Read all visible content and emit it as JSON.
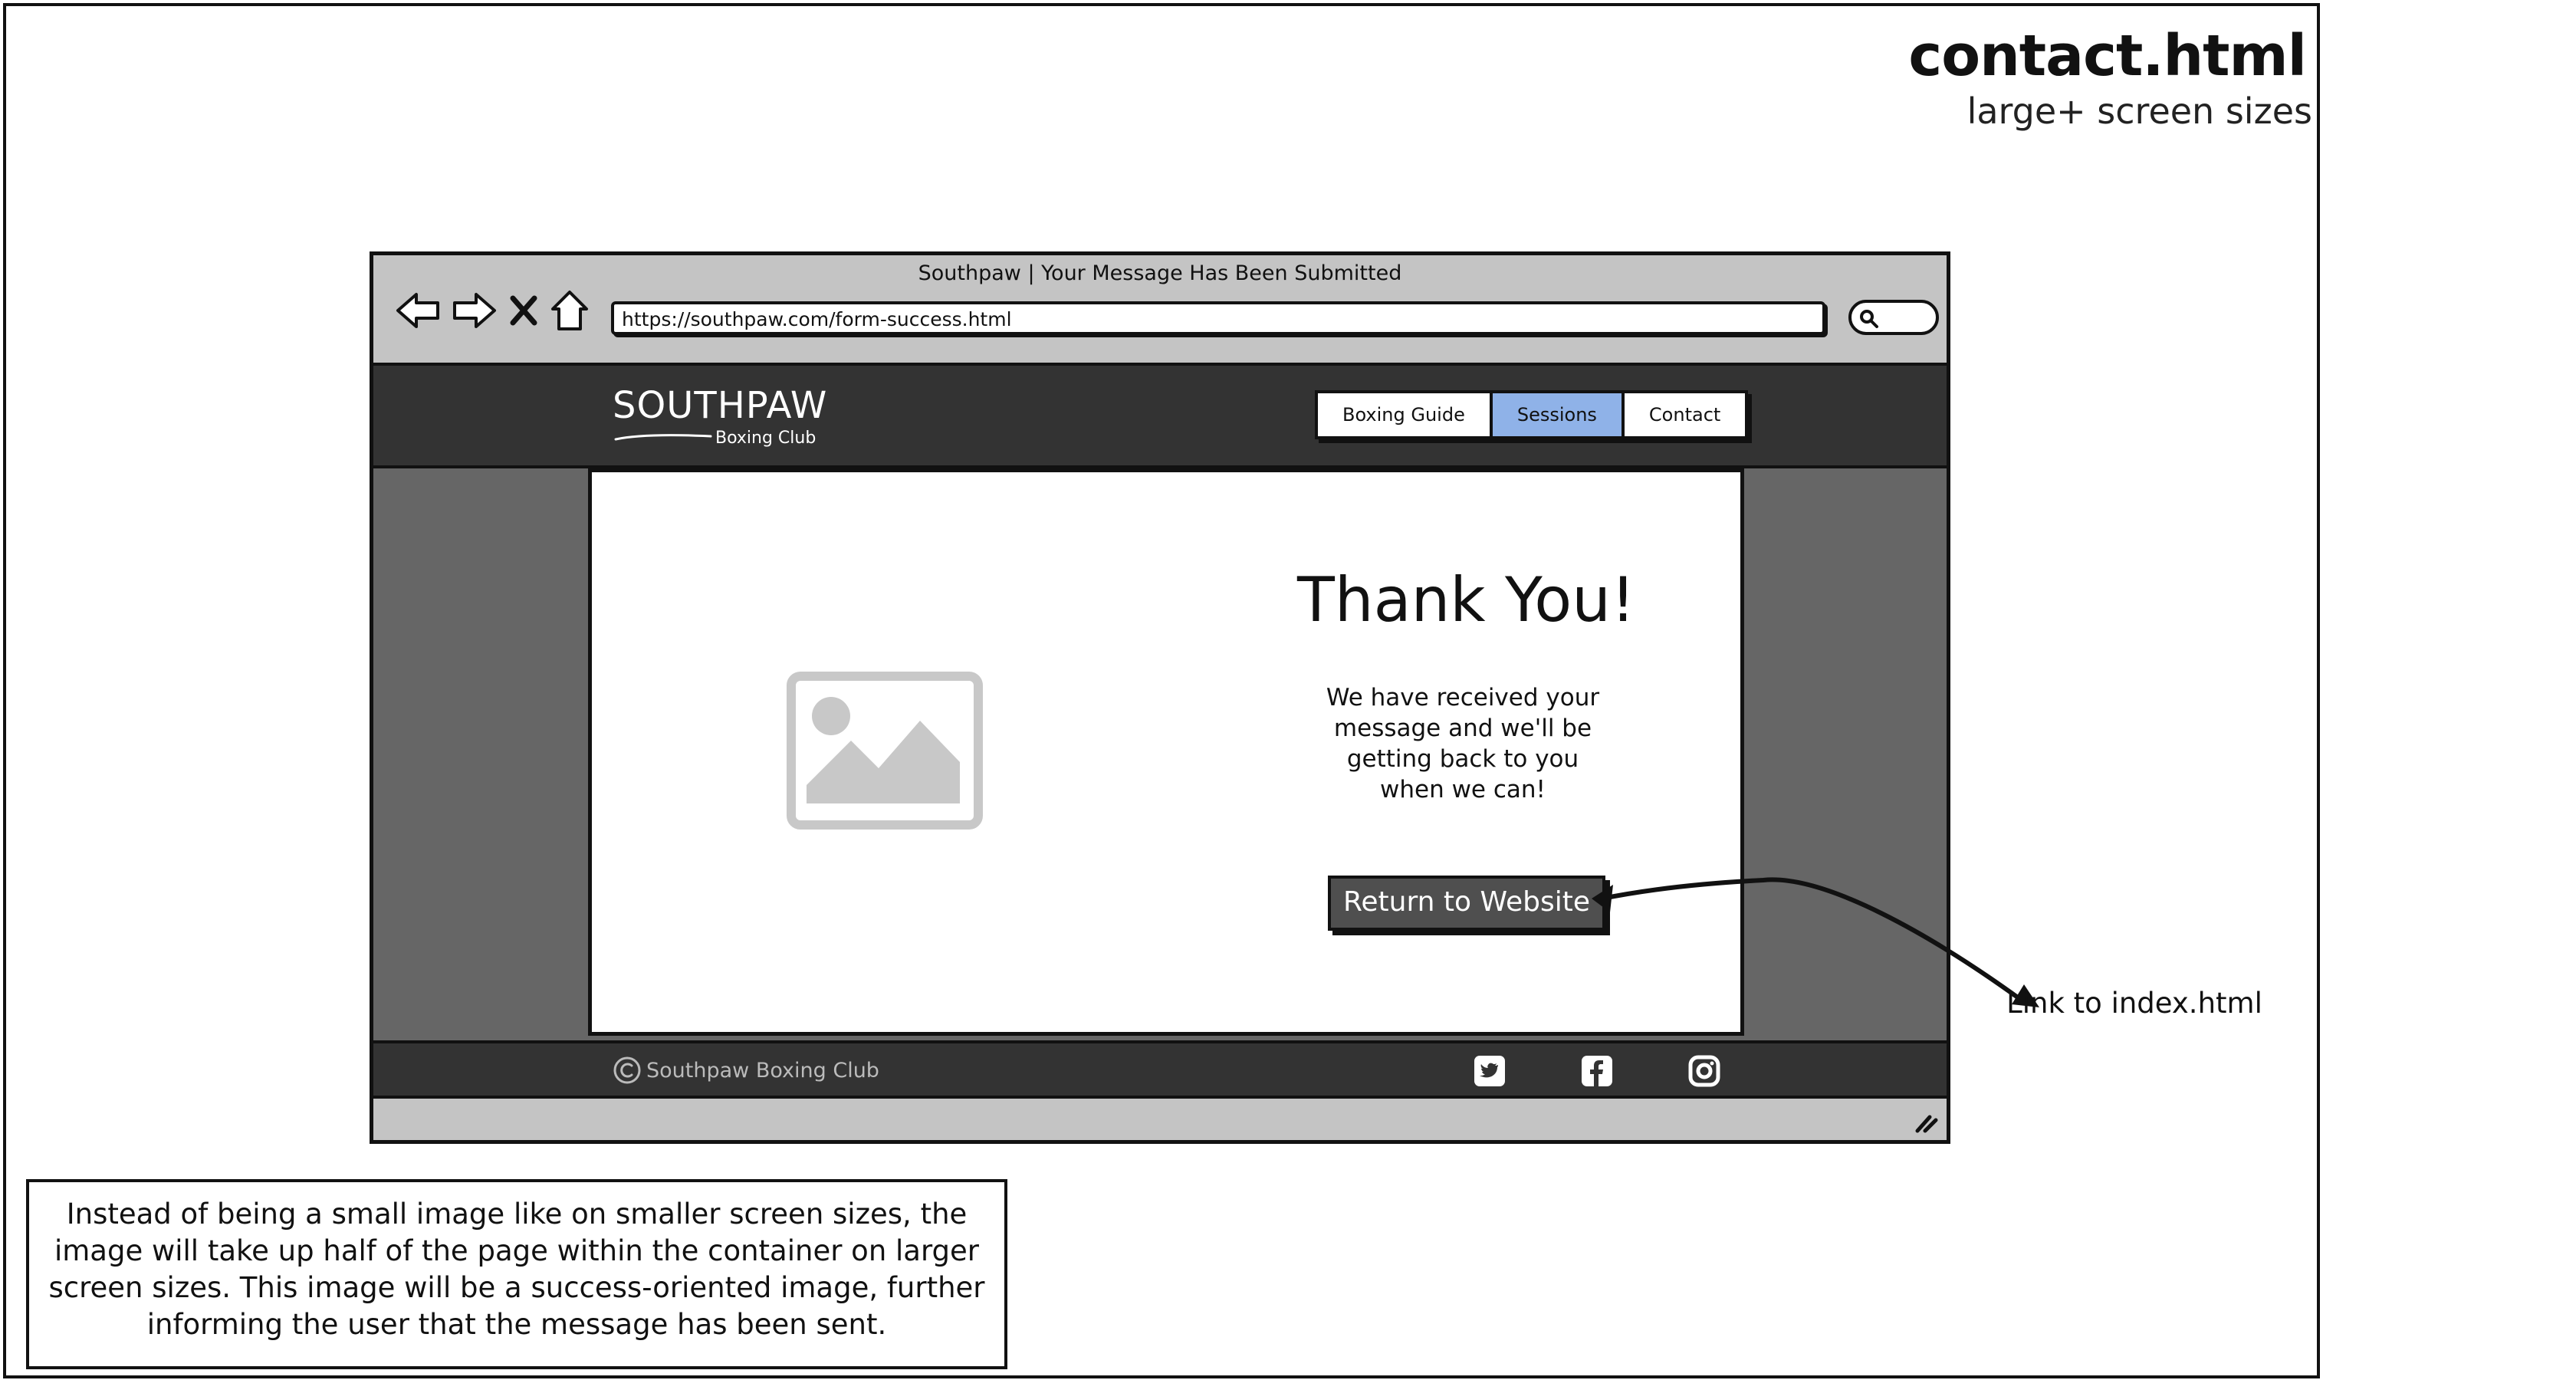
{
  "wireframe": {
    "title": "contact.html",
    "subtitle": "large+ screen sizes"
  },
  "browser": {
    "tab_title": "Southpaw | Your Message Has Been Submitted",
    "url": "https://southpaw.com/form-success.html"
  },
  "site": {
    "logo": {
      "main": "SOUTHPAW",
      "sub": "Boxing Club"
    },
    "nav": [
      {
        "label": "Boxing Guide",
        "active": false
      },
      {
        "label": "Sessions",
        "active": true
      },
      {
        "label": "Contact",
        "active": false
      }
    ],
    "heading": "Thank You!",
    "message": "We have received your message and we'll be getting back to you when we can!",
    "button_label": "Return to Website",
    "footer": {
      "copyright": "Southpaw Boxing Club",
      "social_icons": [
        "twitter-icon",
        "facebook-icon",
        "instagram-icon"
      ]
    }
  },
  "annotations": {
    "link_note": "Link to index.html",
    "image_note": "Instead of being a small image like on smaller screen sizes, the image will take up half of the page within the container on larger screen sizes. This image will be a success-oriented image, further informing the user that the message has been sent."
  },
  "colors": {
    "active_tab": "#8fb2e8",
    "header_bg": "#333333",
    "sidebar_bg": "#666666",
    "browser_chrome": "#c4c4c4"
  }
}
